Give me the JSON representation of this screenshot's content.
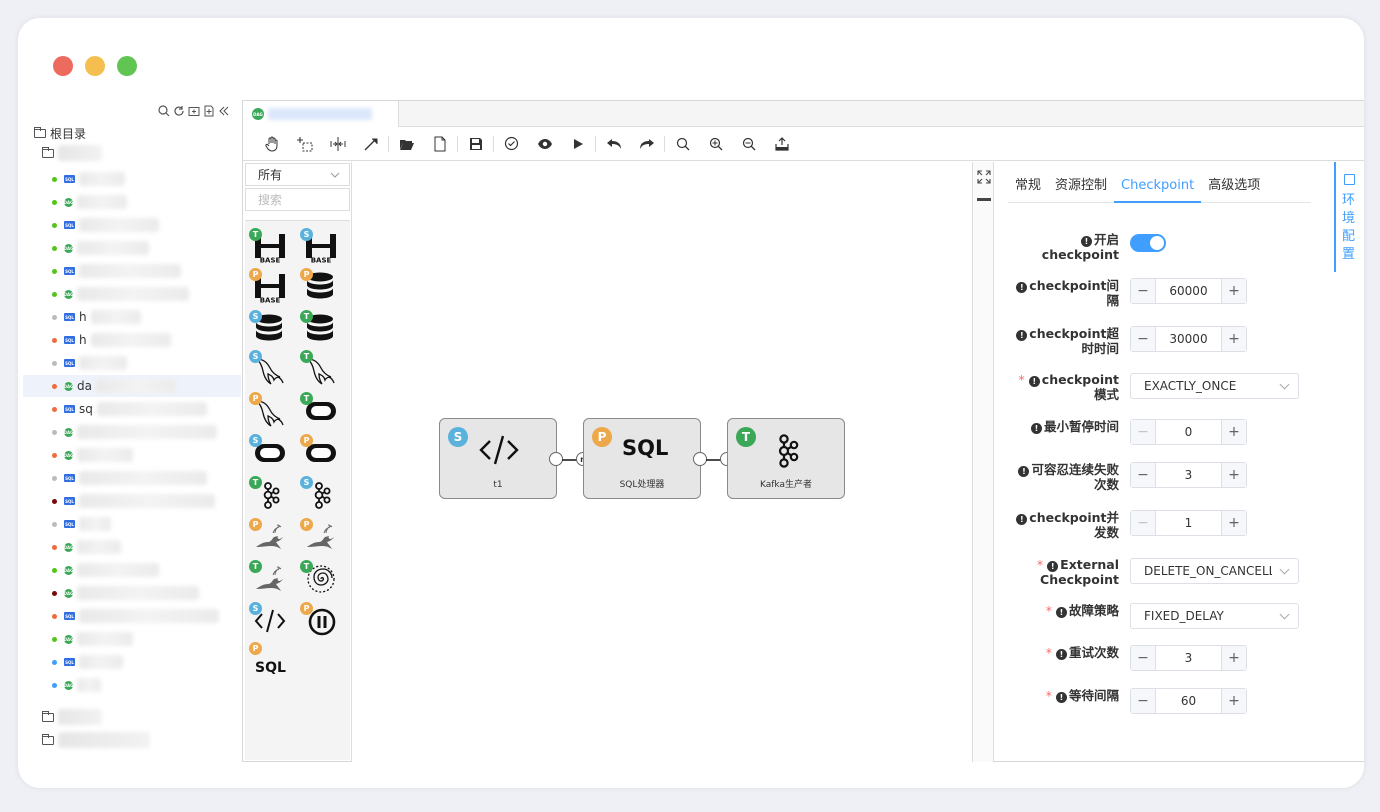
{
  "sidebar": {
    "root_label": "根目录",
    "tree_partial": [
      "da",
      "sq",
      "h",
      "h"
    ]
  },
  "tab": {
    "icon_text": "DAG"
  },
  "palette": {
    "category": "所有",
    "search_placeholder": "搜索",
    "sql_label": "SQL"
  },
  "canvas": {
    "nodes": [
      {
        "badge": "S",
        "label": "t1"
      },
      {
        "badge": "P",
        "label": "SQL处理器",
        "icon_text": "SQL"
      },
      {
        "badge": "T",
        "label": "Kafka生产者"
      }
    ],
    "port_n": "n"
  },
  "panel": {
    "tabs": [
      "常规",
      "资源控制",
      "Checkpoint",
      "高级选项"
    ],
    "active_tab": "Checkpoint",
    "env_tab": "环境配置",
    "fields": {
      "enable": {
        "label": "开启checkpoint",
        "value": true
      },
      "interval": {
        "label": "checkpoint间隔",
        "value": "60000"
      },
      "timeout": {
        "label": "checkpoint超时时间",
        "value": "30000"
      },
      "mode": {
        "label": "checkpoint模式",
        "value": "EXACTLY_ONCE"
      },
      "min_pause": {
        "label": "最小暂停时间",
        "value": "0"
      },
      "tolerable_failures": {
        "label": "可容忍连续失败次数",
        "value": "3"
      },
      "concurrent": {
        "label": "checkpoint并发数",
        "value": "1"
      },
      "external": {
        "label": "External Checkpoint",
        "value": "DELETE_ON_CANCELLATION"
      },
      "failure_strategy": {
        "label": "故障策略",
        "value": "FIXED_DELAY"
      },
      "retry_count": {
        "label": "重试次数",
        "value": "3"
      },
      "wait_interval": {
        "label": "等待间隔",
        "value": "60"
      }
    }
  },
  "colors": {
    "accent": "#409eff",
    "target": "#3aa857",
    "source": "#5ab2dc",
    "process": "#eca84a"
  }
}
